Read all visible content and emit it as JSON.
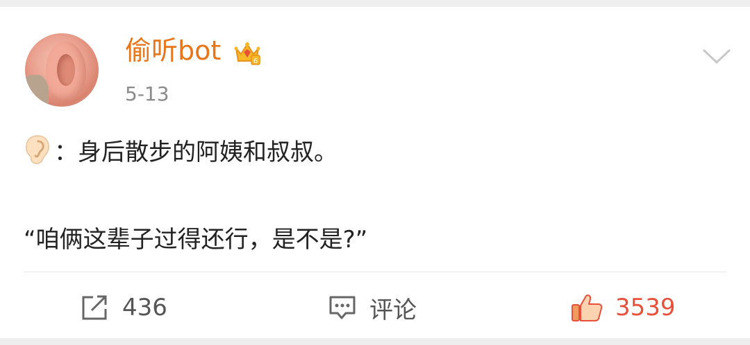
{
  "post": {
    "username": "偷听bot",
    "date": "5-13",
    "line1": "：身后散步的阿姨和叔叔。",
    "line2": "“咱俩这辈子过得还行，是不是?”"
  },
  "actions": {
    "repost_count": "436",
    "comment_label": "评论",
    "like_count": "3539"
  },
  "icons": {
    "avatar": "ear-photo",
    "badge": "vip-crown-icon",
    "emoji": "ear-emoji",
    "menu": "chevron-down-icon",
    "repost": "share-icon",
    "comment": "comment-icon",
    "like": "thumbs-up-icon"
  },
  "colors": {
    "username": "#e8751a",
    "like": "#e8503a",
    "text": "#222222",
    "muted": "#8a8a8a"
  }
}
